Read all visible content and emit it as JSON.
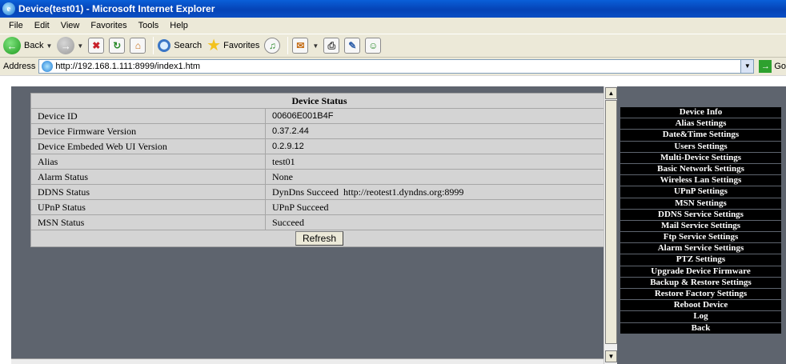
{
  "window": {
    "title": "Device(test01) - Microsoft Internet Explorer"
  },
  "menubar": [
    "File",
    "Edit",
    "View",
    "Favorites",
    "Tools",
    "Help"
  ],
  "toolbar": {
    "back_label": "Back",
    "search_label": "Search",
    "favorites_label": "Favorites"
  },
  "address": {
    "label": "Address",
    "url": "http://192.168.1.111:8999/index1.htm",
    "go_label": "Go"
  },
  "device_status": {
    "title": "Device Status",
    "rows": [
      {
        "label": "Device ID",
        "value": "00606E001B4F"
      },
      {
        "label": "Device Firmware Version",
        "value": "0.37.2.44"
      },
      {
        "label": "Device Embeded Web UI Version",
        "value": "0.2.9.12"
      },
      {
        "label": "Alias",
        "value": "test01"
      },
      {
        "label": "Alarm Status",
        "value": "None"
      },
      {
        "label": "DDNS Status",
        "value": "DynDns Succeed  http://reotest1.dyndns.org:8999"
      },
      {
        "label": "UPnP Status",
        "value": "UPnP Succeed"
      },
      {
        "label": "MSN Status",
        "value": "Succeed"
      }
    ],
    "refresh_label": "Refresh"
  },
  "side_menu": [
    "Device Info",
    "Alias Settings",
    "Date&Time Settings",
    "Users Settings",
    "Multi-Device Settings",
    "Basic Network Settings",
    "Wireless Lan Settings",
    "UPnP Settings",
    "MSN Settings",
    "DDNS Service Settings",
    "Mail Service Settings",
    "Ftp Service Settings",
    "Alarm Service Settings",
    "PTZ Settings",
    "Upgrade Device Firmware",
    "Backup & Restore Settings",
    "Restore Factory Settings",
    "Reboot Device",
    "Log",
    "Back"
  ],
  "colors": {
    "frame_bg": "#5e646e",
    "table_bg": "#d4d4d4",
    "menu_bg": "#000000",
    "title_bar": "#0543b6"
  }
}
